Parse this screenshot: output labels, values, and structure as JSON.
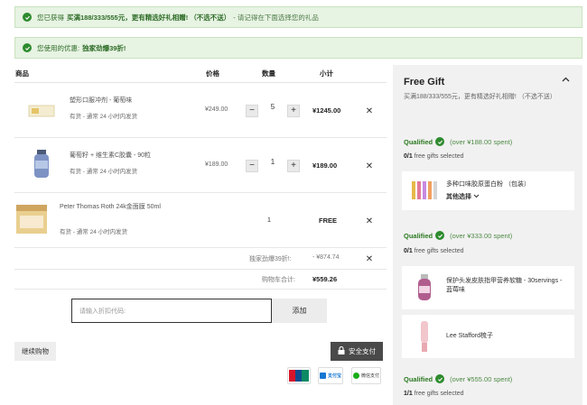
{
  "banners": {
    "gift": {
      "prefix": "您已获得",
      "strong": "买满188/333/555元，更有精选好礼相赠! （不选不送）",
      "suffix": "- 请记得在下面选择您的礼品"
    },
    "coupon": {
      "prefix": "您使用的优惠:",
      "strong": "独家劲爆39折!"
    }
  },
  "cart": {
    "headers": {
      "product": "商品",
      "price": "价格",
      "qty": "数量",
      "subtotal": "小计"
    },
    "items": [
      {
        "name": "塑形口服冲剂 - 葡萄味",
        "stock": "有货 - 通常 24 小时内发货",
        "price": "¥249.00",
        "qty": "5",
        "subtotal": "¥1245.00"
      },
      {
        "name": "葡萄籽 + 维生素C胶囊 - 90粒",
        "stock": "有货 - 通常 24 小时内发货",
        "price": "¥189.00",
        "qty": "1",
        "subtotal": "¥189.00"
      },
      {
        "name": "Peter Thomas Roth 24k金面膜 50ml",
        "stock": "有货 - 通常 24 小时内发货",
        "price": "",
        "qty": "1",
        "subtotal": "FREE"
      }
    ],
    "discount": {
      "label": "独家劲爆39折!:",
      "value": "- ¥874.74"
    },
    "total": {
      "label": "购物车合计:",
      "value": "¥559.26"
    },
    "promo": {
      "placeholder": "请输入折扣代码:",
      "add_label": "添加"
    },
    "continue_label": "继续购物",
    "secure_label": "安全支付",
    "payments": [
      "UnionPay 银联",
      "支付宝 ALIPAY",
      "微信支付"
    ]
  },
  "gift_panel": {
    "title": "Free Gift",
    "desc": "买满188/333/555元，更有精选好礼相赠! （不选不送）",
    "tiers": [
      {
        "qualified": "Qualified",
        "spent": "(over ¥188.00 spent)",
        "count_num": "0/1",
        "count_text": "free gifts selected",
        "gifts": [
          {
            "name": "多种口味胶原蛋白粉 （包装）",
            "select": "其他选择"
          }
        ]
      },
      {
        "qualified": "Qualified",
        "spent": "(over ¥333.00 spent)",
        "count_num": "0/1",
        "count_text": "free gifts selected",
        "gifts": [
          {
            "name": "保护头发皮肤指甲营养软糖 - 30servings - 蓝莓味"
          },
          {
            "name": "Lee Stafford梳子"
          }
        ]
      },
      {
        "qualified": "Qualified",
        "spent": "(over ¥555.00 spent)",
        "count_num": "1/1",
        "count_text": "free gifts selected",
        "gifts": []
      }
    ]
  },
  "colors": {
    "accent_green": "#2e8b2e",
    "banner_bg": "#e7f3e3",
    "dark_button": "#4a4a4a"
  }
}
